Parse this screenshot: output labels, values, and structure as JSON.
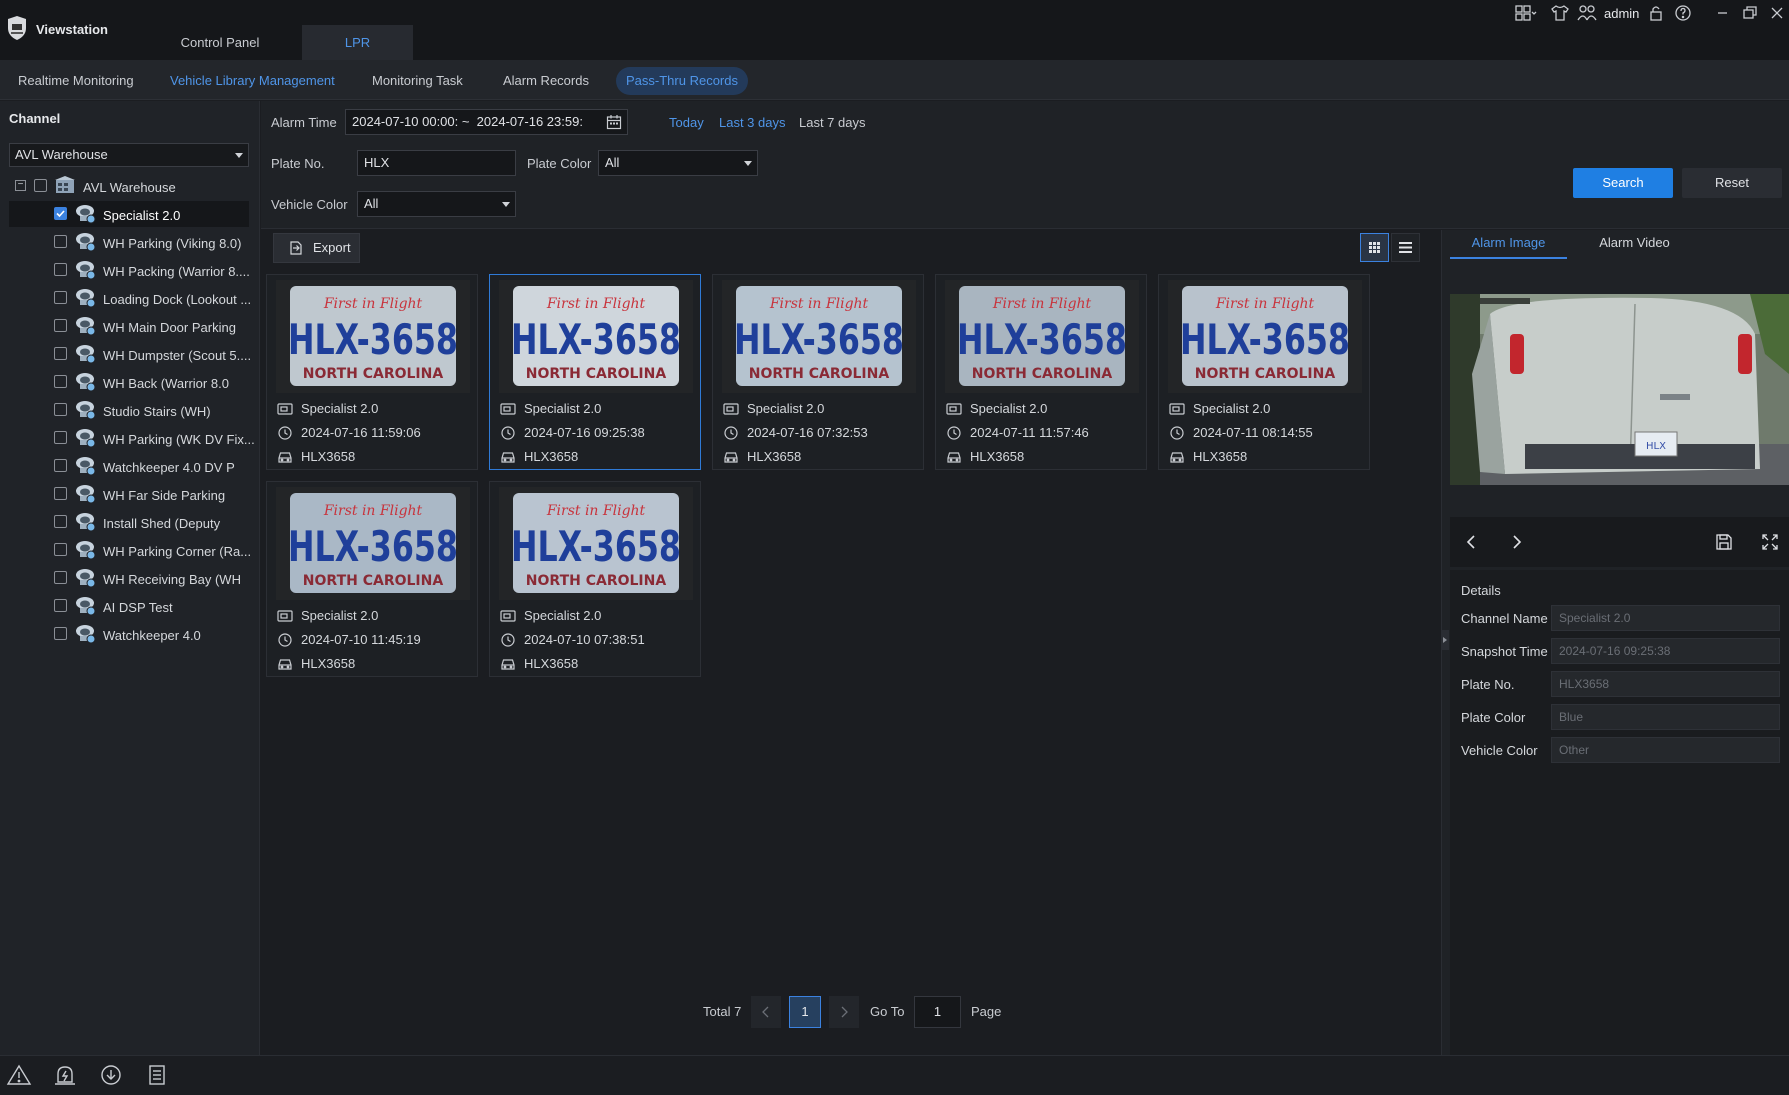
{
  "app": {
    "title": "Viewstation",
    "user": "admin"
  },
  "main_tabs": [
    "Control Panel",
    "LPR"
  ],
  "subnav": [
    "Realtime Monitoring",
    "Vehicle Library Management",
    "Monitoring Task",
    "Alarm Records",
    "Pass-Thru Records"
  ],
  "channel_panel": {
    "title": "Channel",
    "selected_site": "AVL Warehouse",
    "root": "AVL Warehouse",
    "channels": [
      {
        "label": "Specialist 2.0",
        "checked": true
      },
      {
        "label": "WH Parking (Viking 8.0)",
        "checked": false
      },
      {
        "label": "WH Packing (Warrior 8....",
        "checked": false
      },
      {
        "label": "Loading Dock (Lookout ...",
        "checked": false
      },
      {
        "label": "WH Main Door Parking",
        "checked": false
      },
      {
        "label": "WH Dumpster (Scout 5....",
        "checked": false
      },
      {
        "label": "WH Back (Warrior 8.0",
        "checked": false
      },
      {
        "label": "Studio Stairs (WH)",
        "checked": false
      },
      {
        "label": "WH Parking (WK DV Fix...",
        "checked": false
      },
      {
        "label": "Watchkeeper 4.0 DV P",
        "checked": false
      },
      {
        "label": "WH Far Side Parking",
        "checked": false
      },
      {
        "label": "Install Shed (Deputy",
        "checked": false
      },
      {
        "label": "WH Parking Corner (Ra...",
        "checked": false
      },
      {
        "label": "WH Receiving Bay (WH",
        "checked": false
      },
      {
        "label": "AI DSP Test",
        "checked": false
      },
      {
        "label": "Watchkeeper 4.0",
        "checked": false
      }
    ]
  },
  "filters": {
    "alarm_time_label": "Alarm Time",
    "alarm_time_value": "2024-07-10 00:00: ~  2024-07-16 23:59:",
    "quick_today": "Today",
    "quick_3days": "Last 3 days",
    "quick_7days": "Last 7 days",
    "plate_no_label": "Plate No.",
    "plate_no_value": "HLX",
    "plate_color_label": "Plate Color",
    "plate_color_value": "All",
    "vehicle_color_label": "Vehicle Color",
    "vehicle_color_value": "All",
    "search": "Search",
    "reset": "Reset"
  },
  "toolbar": {
    "export": "Export"
  },
  "records": [
    {
      "channel": "Specialist 2.0",
      "time": "2024-07-16 11:59:06",
      "plate": "HLX3658",
      "selected": false
    },
    {
      "channel": "Specialist 2.0",
      "time": "2024-07-16 09:25:38",
      "plate": "HLX3658",
      "selected": true
    },
    {
      "channel": "Specialist 2.0",
      "time": "2024-07-16 07:32:53",
      "plate": "HLX3658",
      "selected": false
    },
    {
      "channel": "Specialist 2.0",
      "time": "2024-07-11 11:57:46",
      "plate": "HLX3658",
      "selected": false
    },
    {
      "channel": "Specialist 2.0",
      "time": "2024-07-11 08:14:55",
      "plate": "HLX3658",
      "selected": false
    },
    {
      "channel": "Specialist 2.0",
      "time": "2024-07-10 11:45:19",
      "plate": "HLX3658",
      "selected": false
    },
    {
      "channel": "Specialist 2.0",
      "time": "2024-07-10 07:38:51",
      "plate": "HLX3658",
      "selected": false
    }
  ],
  "plate_image_text": {
    "top": "First in Flight",
    "number": "HLX-3658",
    "state": "NORTH CAROLINA"
  },
  "pagination": {
    "total": "Total 7",
    "current": "1",
    "goto_label": "Go To",
    "goto_value": "1",
    "page_label": "Page"
  },
  "right_panel": {
    "tabs": [
      "Alarm Image",
      "Alarm Video"
    ],
    "details_title": "Details",
    "details": [
      {
        "label": "Channel Name",
        "value": "Specialist 2.0"
      },
      {
        "label": "Snapshot Time",
        "value": "2024-07-16 09:25:38"
      },
      {
        "label": "Plate No.",
        "value": "HLX3658"
      },
      {
        "label": "Plate Color",
        "value": "Blue"
      },
      {
        "label": "Vehicle Color",
        "value": "Other"
      }
    ]
  },
  "colors": {
    "accent": "#3b82e0",
    "background": "#1b1d21",
    "panel": "#202328"
  }
}
